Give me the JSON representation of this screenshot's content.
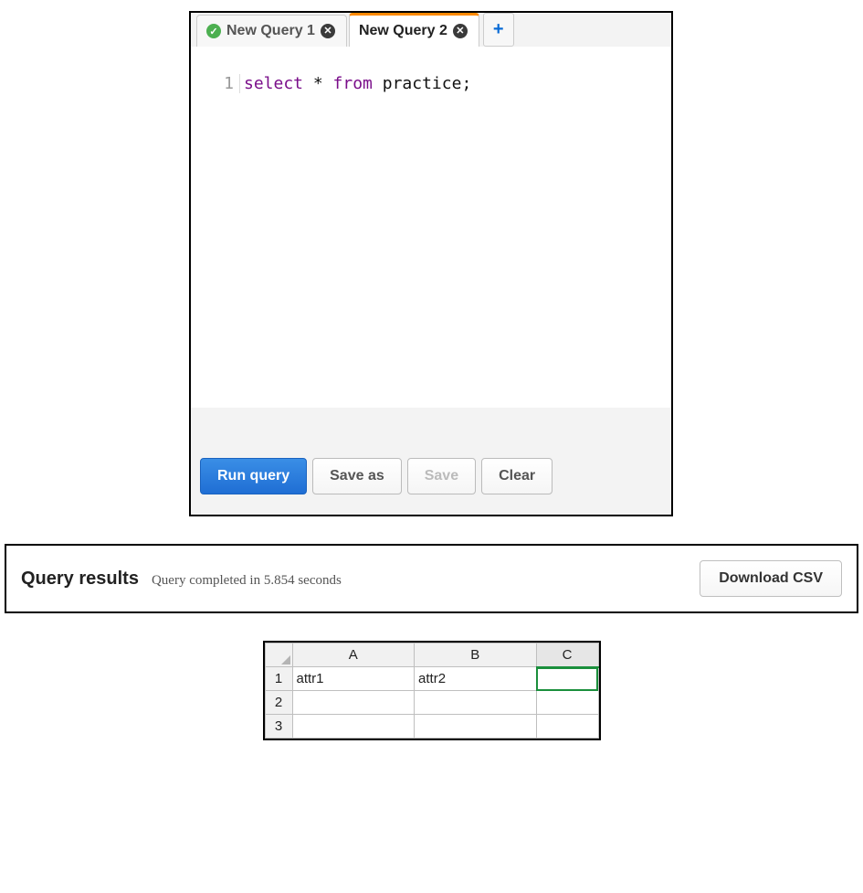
{
  "tabs": [
    {
      "label": "New Query 1",
      "active": false,
      "status": "success"
    },
    {
      "label": "New Query 2",
      "active": true,
      "status": "none"
    }
  ],
  "addTabGlyph": "+",
  "editor": {
    "lineNumber": "1",
    "kw1": "select",
    "star": " * ",
    "kw2": "from",
    "rest": " practice;"
  },
  "toolbar": {
    "run": "Run query",
    "saveas": "Save as",
    "save": "Save",
    "clear": "Clear"
  },
  "results": {
    "title": "Query results",
    "status": "Query completed in 5.854 seconds",
    "download": "Download CSV"
  },
  "sheet": {
    "columns": [
      "A",
      "B",
      "C"
    ],
    "selectedColumnIndex": 2,
    "rows": [
      {
        "num": "1",
        "cells": [
          "attr1",
          "attr2",
          ""
        ]
      },
      {
        "num": "2",
        "cells": [
          "",
          "",
          ""
        ]
      },
      {
        "num": "3",
        "cells": [
          "",
          "",
          ""
        ]
      }
    ]
  }
}
